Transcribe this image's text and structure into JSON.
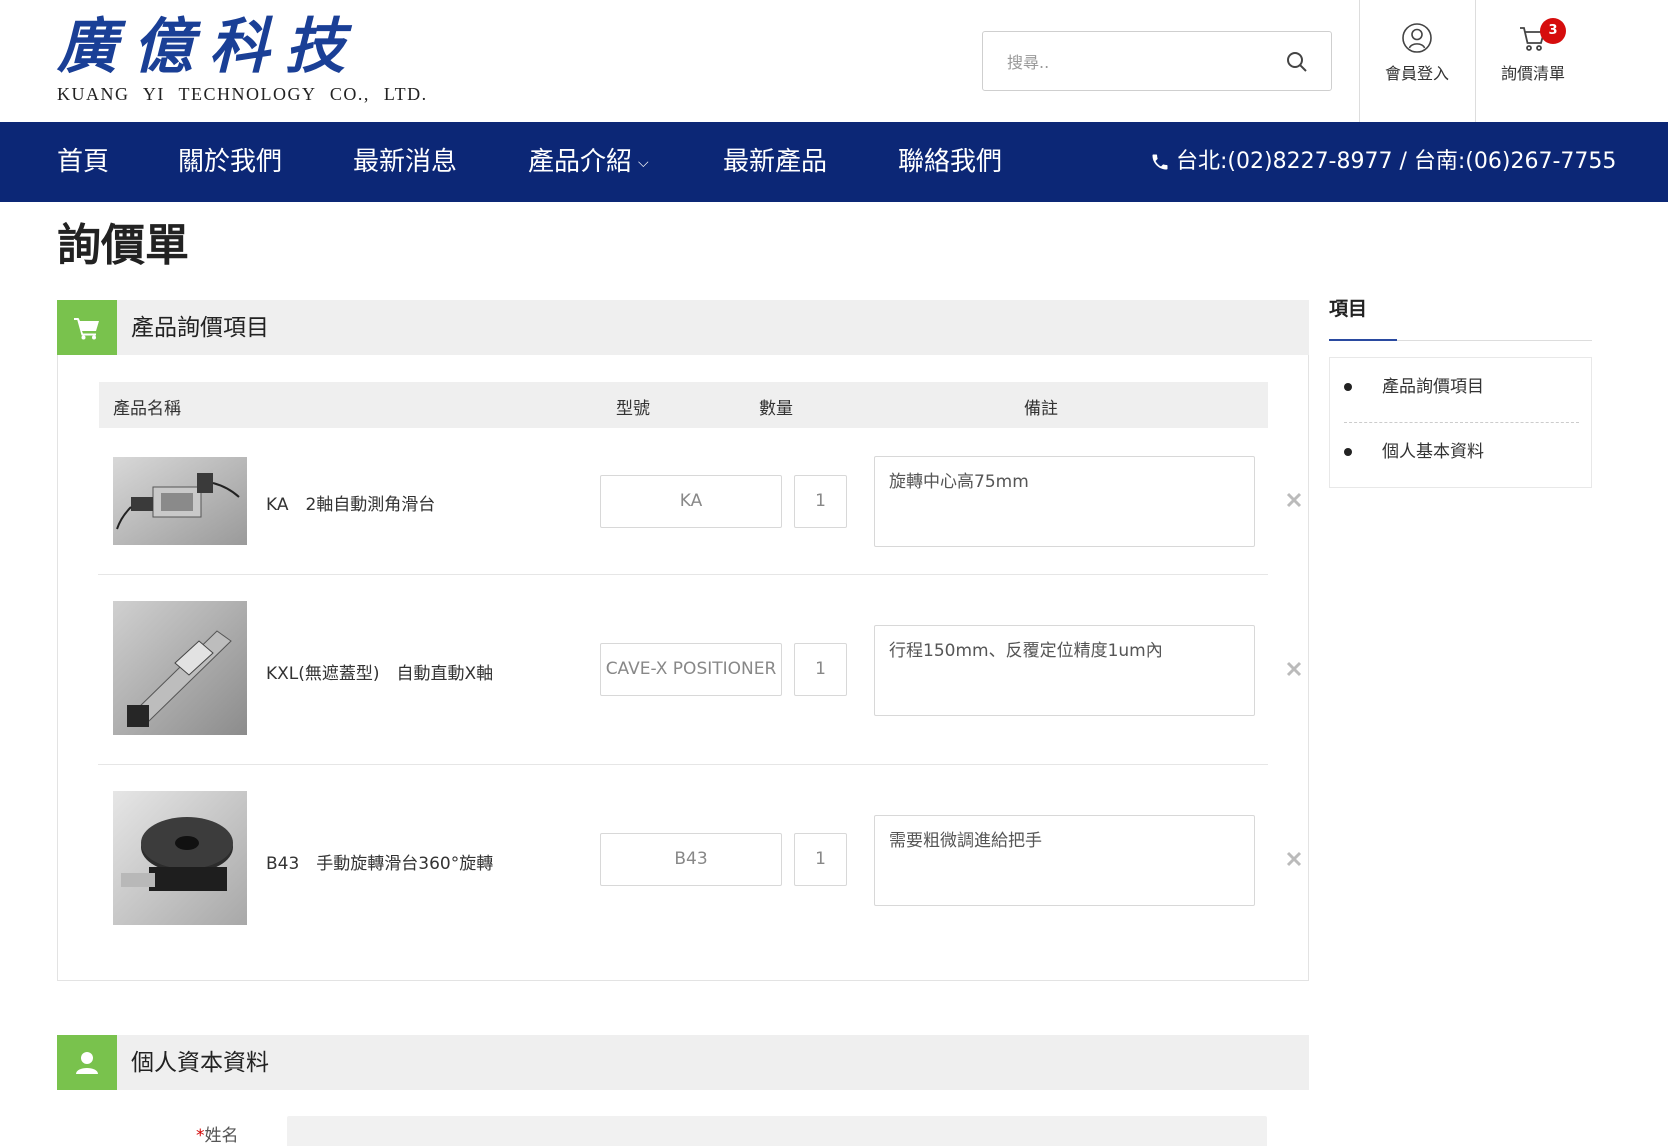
{
  "brand": {
    "name_cn": "廣億科技",
    "name_en": "KUANG YI TECHNOLOGY CO., LTD."
  },
  "search": {
    "placeholder": "搜尋..",
    "value": ""
  },
  "header": {
    "login_label": "會員登入",
    "cart_label": "詢價清單",
    "cart_count": "3"
  },
  "nav": {
    "items": [
      {
        "label": "首頁"
      },
      {
        "label": "關於我們"
      },
      {
        "label": "最新消息"
      },
      {
        "label": "產品介紹",
        "has_dropdown": true
      },
      {
        "label": "最新產品"
      },
      {
        "label": "聯絡我們"
      }
    ],
    "phone": "台北:(02)8227-8977 / 台南:(06)267-7755"
  },
  "page": {
    "title": "詢價單"
  },
  "quote_section": {
    "title": "產品詢價項目",
    "columns": {
      "name": "產品名稱",
      "model": "型號",
      "qty": "數量",
      "note": "備註"
    },
    "rows": [
      {
        "name": "KA　2軸自動測角滑台",
        "model": "KA",
        "qty": "1",
        "note": "旋轉中心高75mm"
      },
      {
        "name": "KXL(無遮蓋型)　自動直動X軸",
        "model": "CAVE-X POSITIONER",
        "qty": "1",
        "note": "行程150mm、反覆定位精度1um內"
      },
      {
        "name": "B43　手動旋轉滑台360°旋轉",
        "model": "B43",
        "qty": "1",
        "note": "需要粗微調進給把手"
      }
    ]
  },
  "personal_section": {
    "title": "個人資本資料",
    "fields": [
      {
        "required_mark": "*",
        "label": "姓名",
        "value": ""
      }
    ]
  },
  "sidebar": {
    "title": "項目",
    "items": [
      {
        "label": "產品詢價項目"
      },
      {
        "label": "個人基本資料"
      }
    ]
  },
  "colors": {
    "nav_bg": "#0c2776",
    "accent_green": "#79c24d",
    "brand_blue": "#1a3f96",
    "badge_red": "#d60d0d"
  }
}
